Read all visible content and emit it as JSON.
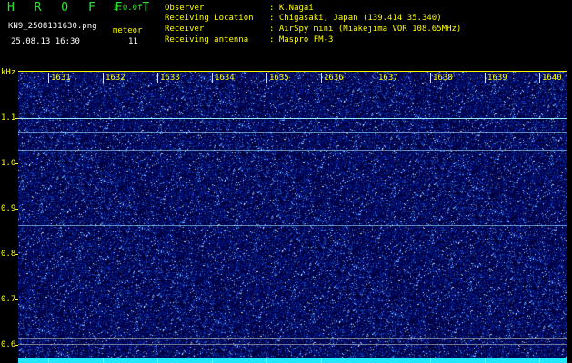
{
  "header": {
    "app_title": "H R O F F T",
    "version": "1.0.0f",
    "file_name": "KN9_2508131630.png",
    "timestamp": "25.08.13 16:30",
    "meteor_label": "meteor",
    "meteor_count": "11"
  },
  "info": [
    {
      "key": "Observer",
      "value": ": K.Nagai"
    },
    {
      "key": "Receiving Location",
      "value": ": Chigasaki, Japan (139.414 35.340)"
    },
    {
      "key": "Receiver",
      "value": ": AirSpy mini (Miakejima VOR 108.65MHz)"
    },
    {
      "key": "Receiving antenna",
      "value": ": Maspro FM-3"
    }
  ],
  "time_axis": {
    "labels": [
      "1631",
      "1632",
      "1633",
      "1634",
      "1635",
      "1636",
      "1637",
      "1638",
      "1639",
      "1640"
    ]
  },
  "freq_axis": {
    "unit": "kHz",
    "labels": [
      "1.1",
      "1.0",
      "0.9",
      "0.8",
      "0.7",
      "0.6"
    ]
  },
  "colors": {
    "axis": "#ffff00",
    "header_green": "#2ee52e",
    "background": "#000000",
    "spectrum_base": "#00003c",
    "carrier_line": "#9ff0ff",
    "bottom_band": "#22e8ff"
  },
  "carriers_khz": [
    1.1,
    1.068,
    1.031,
    0.865,
    0.615,
    0.603
  ]
}
